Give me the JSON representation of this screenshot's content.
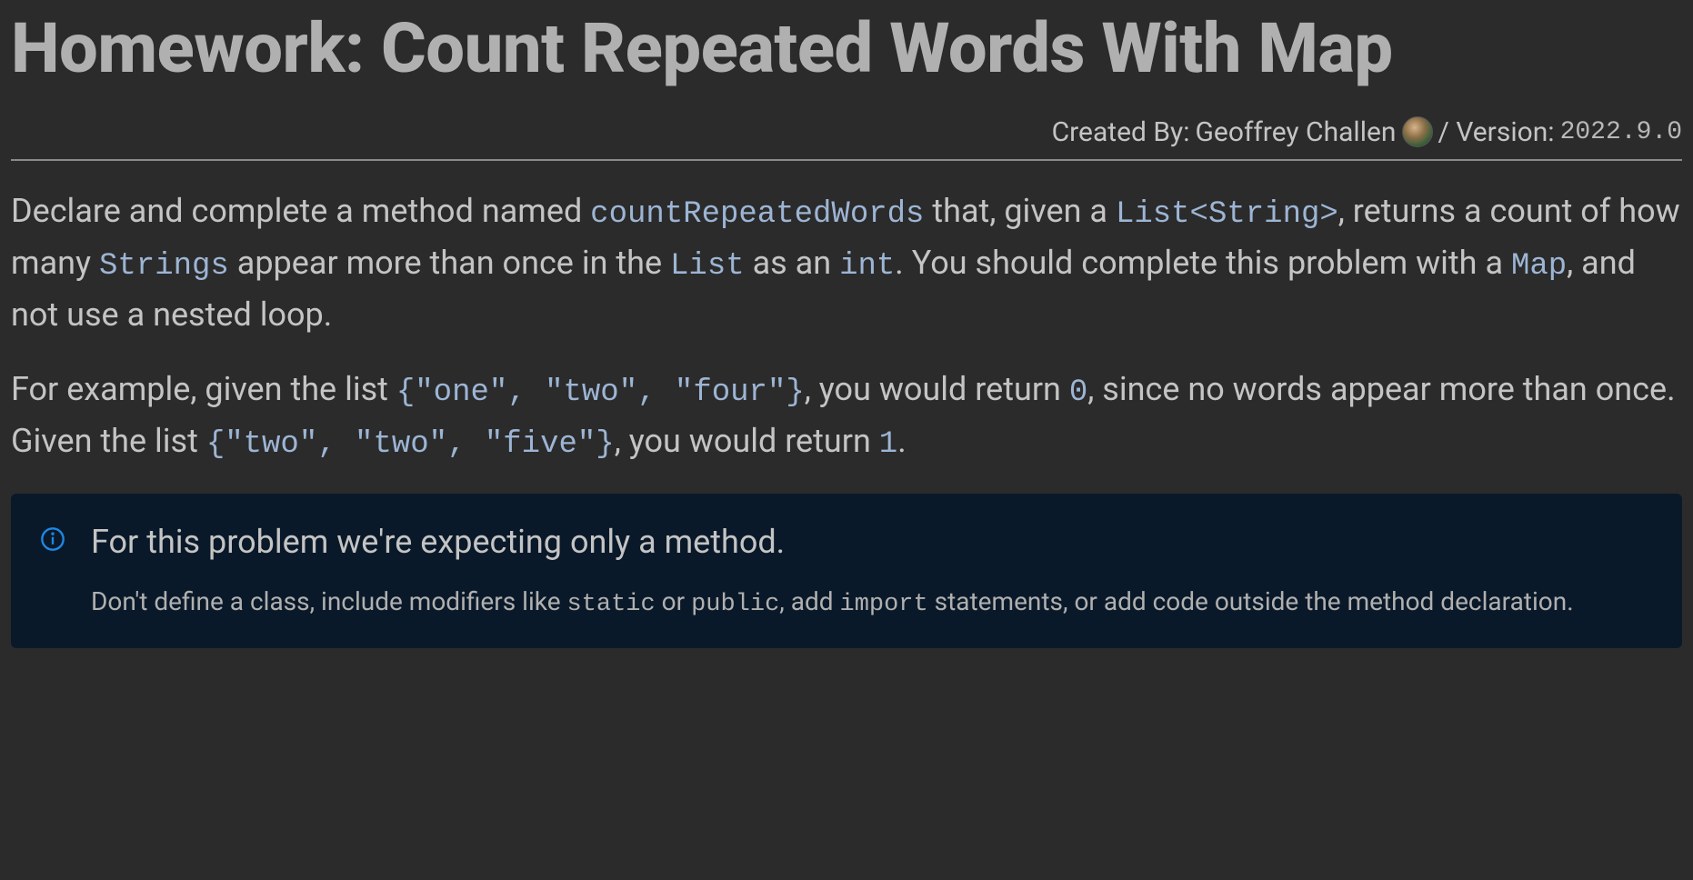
{
  "title": "Homework: Count Repeated Words With Map",
  "meta": {
    "created_by_label": "Created By:",
    "author": "Geoffrey Challen",
    "version_label": "/ Version:",
    "version": "2022.9.0"
  },
  "description": {
    "p1": {
      "t1": "Declare and complete a method named ",
      "c1": "countRepeatedWords",
      "t2": " that, given a ",
      "c2": "List<String>",
      "t3": ", returns a count of how many ",
      "c3": "Strings",
      "t4": " appear more than once in the ",
      "c4": "List",
      "t5": " as an ",
      "c5": "int",
      "t6": ". You should complete this problem with a ",
      "c6": "Map",
      "t7": ", and not use a nested loop."
    },
    "p2": {
      "t1": "For example, given the list ",
      "c1": "{\"one\", \"two\", \"four\"}",
      "t2": ", you would return ",
      "c2": "0",
      "t3": ", since no words appear more than once. Given the list ",
      "c3": "{\"two\", \"two\", \"five\"}",
      "t4": ", you would return ",
      "c4": "1",
      "t5": "."
    }
  },
  "info": {
    "heading": "For this problem we're expecting only a method.",
    "body": {
      "t1": "Don't define a class, include modifiers like ",
      "c1": "static",
      "t2": " or ",
      "c2": "public",
      "t3": ", add ",
      "c3": "import",
      "t4": " statements, or add code outside the method declaration."
    }
  }
}
